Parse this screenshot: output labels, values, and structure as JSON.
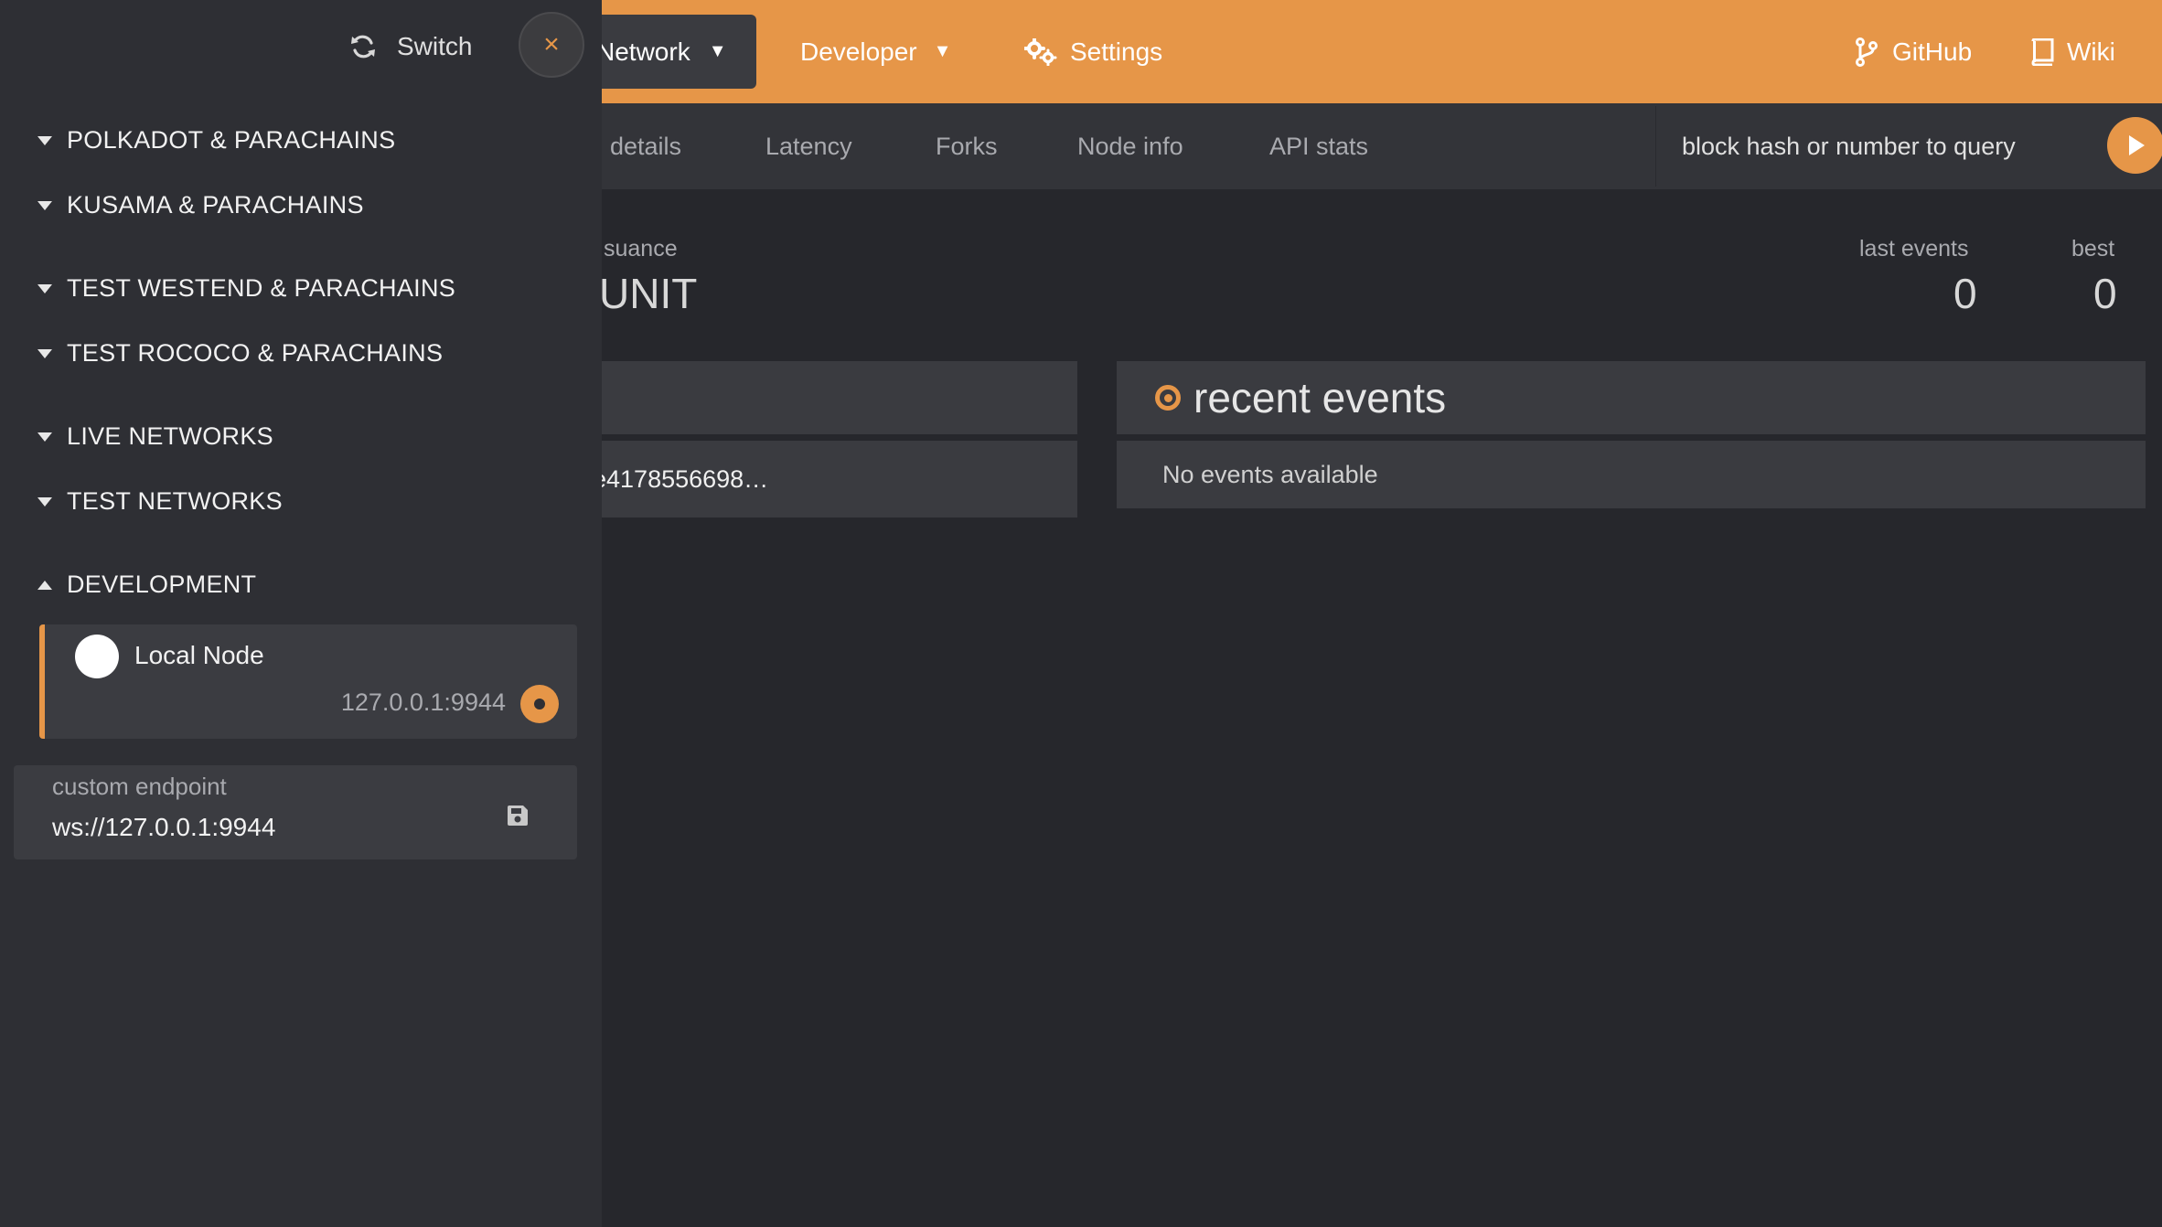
{
  "topbar": {
    "network_label": "Network",
    "developer_label": "Developer",
    "settings_label": "Settings",
    "github_label": "GitHub",
    "wiki_label": "Wiki"
  },
  "tabs": [
    "details",
    "Latency",
    "Forks",
    "Node info",
    "API stats"
  ],
  "query": {
    "placeholder": "block hash or number to query"
  },
  "summary": {
    "issuance_label": "suance",
    "issuance_value": "UNIT",
    "last_events_label": "last events",
    "last_events_value": "0",
    "best_label": "best",
    "best_value": "0"
  },
  "left_panel": {
    "hash": "e4178556698…"
  },
  "recent_events": {
    "title": "recent events",
    "empty_text": "No events available"
  },
  "sidebar": {
    "switch_label": "Switch",
    "close_symbol": "×",
    "groups": [
      "POLKADOT & PARACHAINS",
      "KUSAMA & PARACHAINS",
      "TEST WESTEND & PARACHAINS",
      "TEST ROCOCO & PARACHAINS",
      "LIVE NETWORKS",
      "TEST NETWORKS",
      "DEVELOPMENT"
    ],
    "node": {
      "name": "Local Node",
      "url": "127.0.0.1:9944"
    },
    "custom": {
      "label": "custom endpoint",
      "value": "ws://127.0.0.1:9944"
    }
  },
  "colors": {
    "accent": "#e69648",
    "sidebar_bg": "#2e2f34",
    "page_bg": "#26272c"
  },
  "icons": [
    "refresh-icon",
    "close-icon",
    "chevron-down-icon",
    "chevron-up-icon",
    "cogs-icon",
    "git-branch-icon",
    "book-icon",
    "play-icon",
    "save-icon"
  ]
}
